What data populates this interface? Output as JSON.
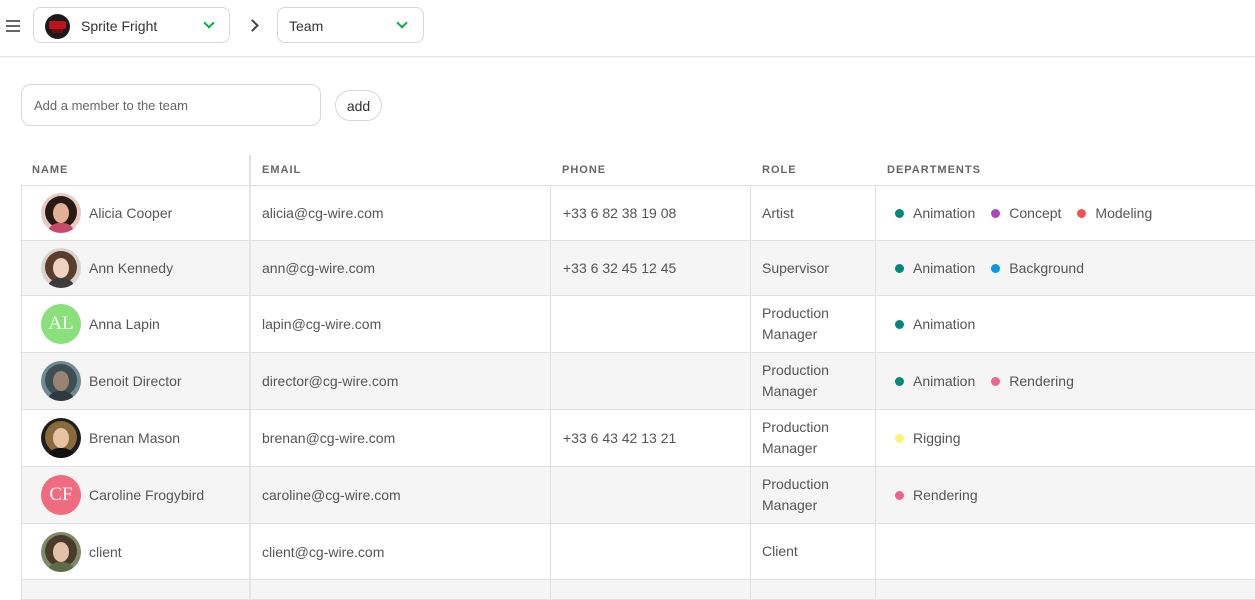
{
  "topbar": {
    "production": "Sprite Fright",
    "section": "Team"
  },
  "add_member": {
    "placeholder": "Add a member to the team",
    "button": "add"
  },
  "table": {
    "headers": {
      "name": "NAME",
      "email": "EMAIL",
      "phone": "PHONE",
      "role": "ROLE",
      "departments": "DEPARTMENTS"
    },
    "rows": [
      {
        "name": "Alicia Cooper",
        "email": "alicia@cg-wire.com",
        "phone": "+33 6 82 38 19 08",
        "role": "Artist"
      },
      {
        "name": "Ann Kennedy",
        "email": "ann@cg-wire.com",
        "phone": "+33 6 32 45 12 45",
        "role": "Supervisor"
      },
      {
        "name": "Anna Lapin",
        "initials": "AL",
        "email": "lapin@cg-wire.com",
        "phone": "",
        "role": "Production Manager"
      },
      {
        "name": "Benoit Director",
        "email": "director@cg-wire.com",
        "phone": "",
        "role": "Production Manager"
      },
      {
        "name": "Brenan Mason",
        "email": "brenan@cg-wire.com",
        "phone": "+33 6 43 42 13 21",
        "role": "Production Manager"
      },
      {
        "name": "Caroline Frogybird",
        "initials": "CF",
        "email": "caroline@cg-wire.com",
        "phone": "",
        "role": "Production Manager"
      },
      {
        "name": "client",
        "email": "client@cg-wire.com",
        "phone": "",
        "role": "Client"
      }
    ],
    "departments": [
      [
        {
          "name": "Animation",
          "color": "#00897b"
        },
        {
          "name": "Concept",
          "color": "#ab47bc"
        },
        {
          "name": "Modeling",
          "color": "#ef5350"
        }
      ],
      [
        {
          "name": "Animation",
          "color": "#00897b"
        },
        {
          "name": "Background",
          "color": "#039be5"
        }
      ],
      [
        {
          "name": "Animation",
          "color": "#00897b"
        }
      ],
      [
        {
          "name": "Animation",
          "color": "#00897b"
        },
        {
          "name": "Rendering",
          "color": "#f06292"
        }
      ],
      [
        {
          "name": "Rigging",
          "color": "#fff176"
        }
      ],
      [
        {
          "name": "Rendering",
          "color": "#f06292"
        }
      ],
      []
    ]
  },
  "colors": {
    "accent_green": "#00b242",
    "avatar_al": "#8ae07a",
    "avatar_cf": "#f06b7e",
    "row_alt": "#f5f5f5",
    "border": "#e0e0e0"
  }
}
